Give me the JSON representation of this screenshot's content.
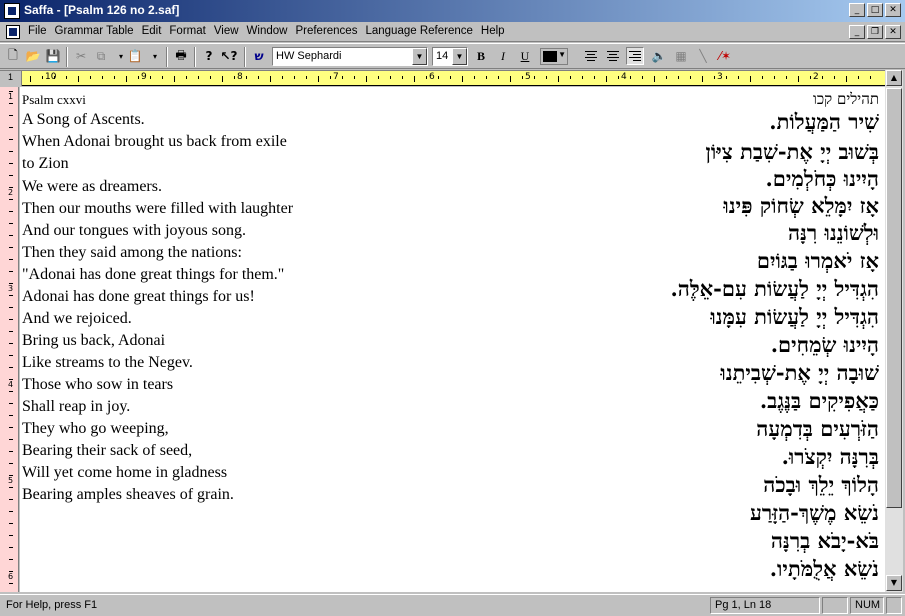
{
  "window": {
    "title": "Saffa - [Psalm 126 no 2.saf]"
  },
  "menus": [
    "File",
    "Grammar Table",
    "Edit",
    "Format",
    "View",
    "Window",
    "Preferences",
    "Language Reference",
    "Help"
  ],
  "toolbar": {
    "font_name": "HW Sephardi",
    "font_size": "14",
    "bold_label": "B",
    "italic_label": "I",
    "underline_label": "U",
    "current_color": "#000000"
  },
  "ruler": {
    "h_numbers": [
      "10",
      "9",
      "8",
      "7",
      "6",
      "5",
      "4",
      "3",
      "2",
      "1"
    ],
    "v_numbers": [
      "1",
      "2",
      "3",
      "4",
      "5",
      "6"
    ]
  },
  "document": {
    "english": [
      "Psalm  cxxvi",
      "A Song of Ascents.",
      "When Adonai brought us back from exile",
      "to Zion",
      "We were as dreamers.",
      "Then our mouths were filled with laughter",
      "And our tongues with joyous song.",
      "Then they said among the nations:",
      "\"Adonai has done great things for them.\"",
      "Adonai has done great things for us!",
      "And we rejoiced.",
      "Bring us back, Adonai",
      "Like streams to the Negev.",
      "Those who sow in tears",
      "Shall reap in joy.",
      "They who go weeping,",
      "Bearing their sack of seed,",
      "Will yet come home in gladness",
      "Bearing amples sheaves of grain."
    ],
    "hebrew": [
      "תהילים קכו",
      "שִׁיר הַמַּעֲלוֹת.",
      "בְּשׁוּב יְיָ אֶת-שִׁבַת צִיּוֹן",
      "הָיִינוּ כְּחֹלְמִים.",
      "אָז יִמָּלֵא שְׂחוֹק פִּינוּ",
      "וּלְשׁוֹנֵנוּ רִנָּה",
      "אָז יֹאמְרוּ בַגּוֹיִם",
      "הִגְדִּיל יְיָ לַעֲשׂוֹת עִם-אֵלֶּה.",
      "הִגְדִּיל יְיָ לַעֲשׂוֹת עִמָּנוּ",
      "הָיִינוּ שְׂמֵחִים.",
      "שׁוּבָה יְיָ אֶת-שְׁבִיתֵנוּ",
      "כַּאֲפִיקִים בַּנֶּגֶב.",
      "הַזֹּרְעִים בְּדִמְעָה",
      "בְּרִנָּה יִקְצֹרוּ.",
      "הָלוֹךְ יֵלֵךְ וּבָכֹה",
      "נֹשֵׂא מֶשֶׁךְ-הַזָּרַע",
      "בֹּא-יָבֹא בְרִנָּה",
      "נֹשֵׂא אֲלֻמֹּתָיו."
    ]
  },
  "status": {
    "help": "For Help, press F1",
    "position": "Pg 1, Ln 18",
    "num": "NUM"
  }
}
